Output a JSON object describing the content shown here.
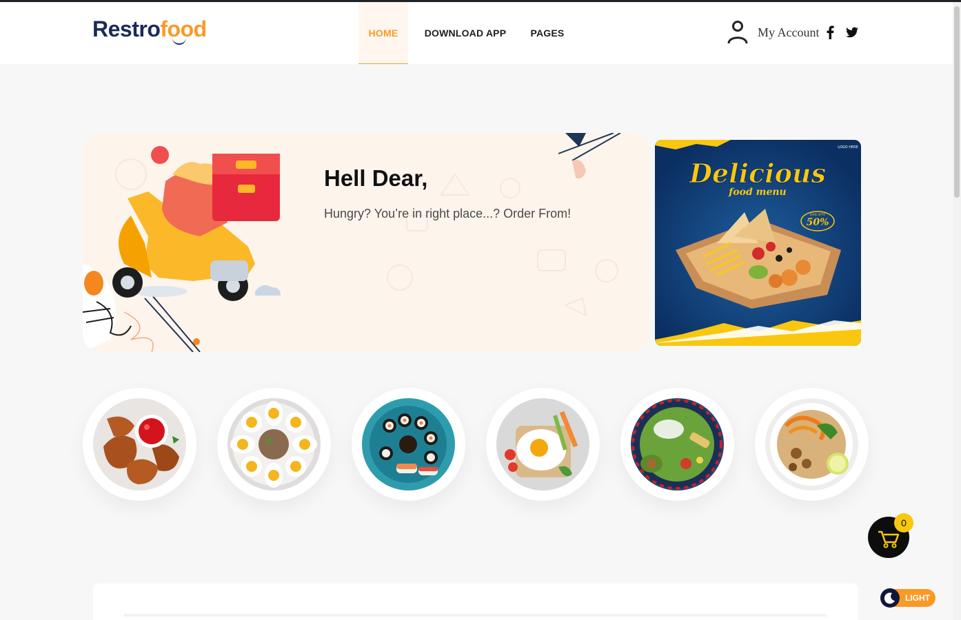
{
  "brand": {
    "logo_part1": "Restro",
    "logo_part2": "food"
  },
  "nav": {
    "items": [
      {
        "label": "HOME",
        "active": true
      },
      {
        "label": "DOWNLOAD APP",
        "active": false
      },
      {
        "label": "PAGES",
        "active": false
      }
    ]
  },
  "account": {
    "label": "My Account"
  },
  "social": {
    "facebook": "facebook-icon",
    "twitter": "twitter-icon"
  },
  "hero": {
    "title": "Hell Dear,",
    "subtitle": "Hungry? You’re in right place...? Order From!"
  },
  "promo": {
    "headline": "Delicious",
    "sub": "food menu",
    "badge_small": "SAVE UPTO",
    "badge": "50%",
    "logo": "LOGO HERE"
  },
  "categories": [
    {
      "name": "chicken-wings"
    },
    {
      "name": "deviled-eggs"
    },
    {
      "name": "sushi-platter"
    },
    {
      "name": "fried-egg-toast"
    },
    {
      "name": "salad-bowl"
    },
    {
      "name": "noodle-bowl"
    }
  ],
  "cart": {
    "count": "0"
  },
  "theme": {
    "label": "LIGHT"
  },
  "colors": {
    "accent": "#f99a26",
    "brand_dark": "#1b2a5a",
    "promo_blue": "#0f3d78",
    "badge_yellow": "#f9c70f"
  }
}
